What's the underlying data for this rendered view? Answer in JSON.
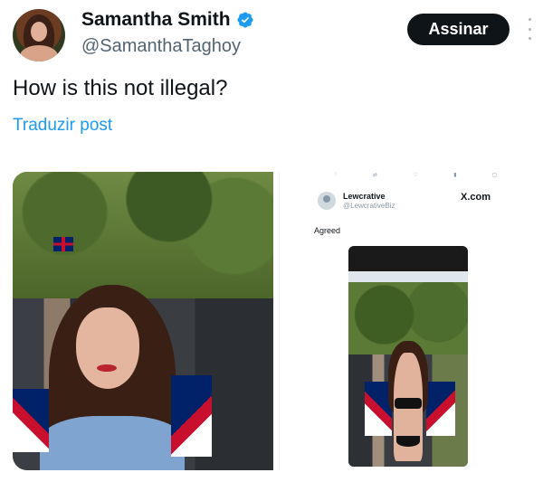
{
  "author": {
    "display_name": "Samantha Smith",
    "handle": "@SamanthaTaghoy",
    "verified": true,
    "avatar_icon": "profile-photo-avatar"
  },
  "actions": {
    "follow_label": "Assinar",
    "more_icon": "vertical-ellipsis-icon"
  },
  "post": {
    "text": "How is this not illegal?",
    "translate_label": "Traduzir post"
  },
  "media": {
    "screenshot": {
      "author_name": "Lewcrative",
      "author_handle": "@LewcrativeBiz",
      "brand": "X.com",
      "reply_text": "Agreed"
    }
  },
  "colors": {
    "link": "#1d9bf0",
    "button_bg": "#0f1419",
    "verified_badge": "#1d9bf0",
    "secondary_text": "#536471"
  }
}
